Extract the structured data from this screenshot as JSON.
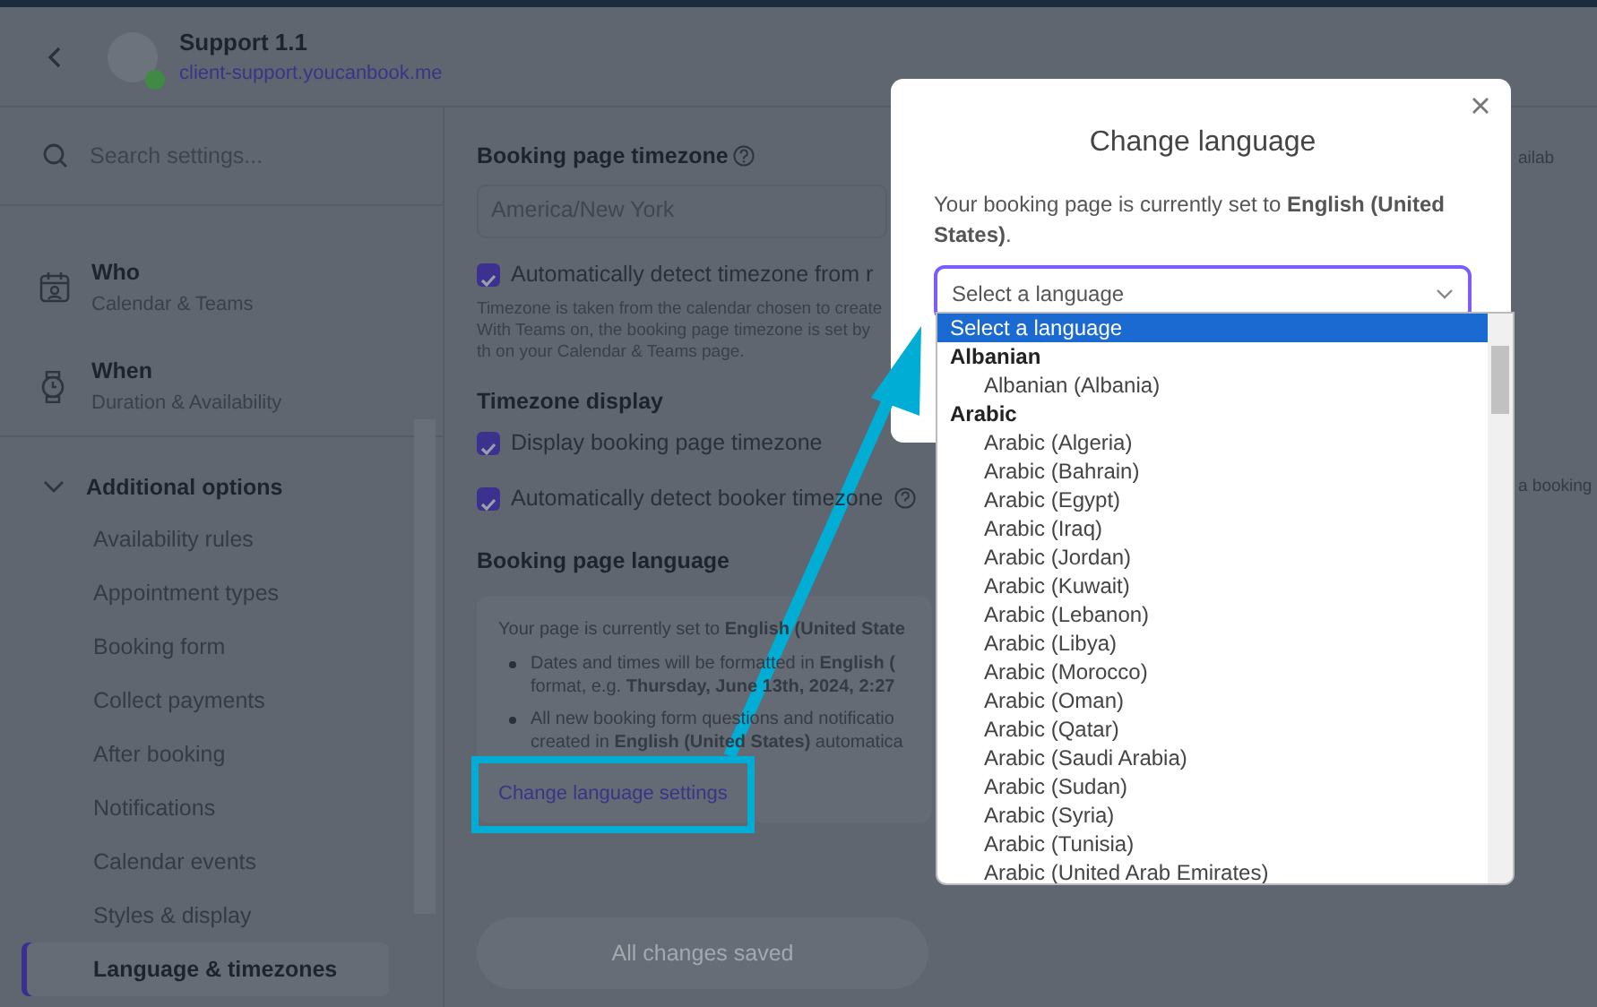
{
  "header": {
    "title": "Support 1.1",
    "url": "client-support.youcanbook.me",
    "online": true
  },
  "sidebar": {
    "search": {
      "placeholder": "Search settings..."
    },
    "sections": [
      {
        "title": "Who",
        "subtitle": "Calendar & Teams"
      },
      {
        "title": "When",
        "subtitle": "Duration & Availability"
      }
    ],
    "group": {
      "title": "Additional options",
      "expanded": true,
      "items": [
        {
          "label": "Availability rules",
          "selected": false
        },
        {
          "label": "Appointment types",
          "selected": false
        },
        {
          "label": "Booking form",
          "selected": false
        },
        {
          "label": "Collect payments",
          "selected": false
        },
        {
          "label": "After booking",
          "selected": false
        },
        {
          "label": "Notifications",
          "selected": false
        },
        {
          "label": "Calendar events",
          "selected": false
        },
        {
          "label": "Styles & display",
          "selected": false
        },
        {
          "label": "Language & timezones",
          "selected": true
        }
      ]
    }
  },
  "main": {
    "timezone": {
      "heading": "Booking page timezone",
      "value": "America/New York",
      "auto": {
        "label": "Automatically detect timezone from r",
        "checked": true
      },
      "help": "Timezone is taken from the calendar chosen to create With Teams on, the booking page timezone is set by th on your Calendar & Teams page."
    },
    "display": {
      "heading": "Timezone display",
      "options": [
        {
          "label": "Display booking page timezone",
          "checked": true
        },
        {
          "label": "Automatically detect booker timezone",
          "checked": true
        }
      ]
    },
    "language": {
      "heading": "Booking page language",
      "current": "Your page is currently set to **English (United State**",
      "bullets": [
        "Dates and times will be formatted in **English (** format, e.g. **Thursday, June 13th, 2024, 2:27**",
        "All new booking form questions and notificatio created in **English (United States)** automatica"
      ],
      "link": "Change language settings"
    },
    "save": {
      "label": "All changes saved",
      "disabled": true
    }
  },
  "right_fragments": [
    "ailab",
    "a booking"
  ],
  "modal": {
    "title": "Change language",
    "text": "Your booking page is currently set to **English (United States)**.",
    "select": {
      "placeholder": "Select a language",
      "expanded": true
    },
    "options": [
      {
        "label": "Select a language",
        "selected": true
      }
    ],
    "groups": [
      {
        "label": "Albanian",
        "children": [
          {
            "label": "Albanian (Albania)",
            "selected": false
          }
        ]
      },
      {
        "label": "Arabic",
        "children": [
          {
            "label": "Arabic (Algeria)",
            "selected": false
          },
          {
            "label": "Arabic (Bahrain)",
            "selected": false
          },
          {
            "label": "Arabic (Egypt)",
            "selected": false
          },
          {
            "label": "Arabic (Iraq)",
            "selected": false
          },
          {
            "label": "Arabic (Jordan)",
            "selected": false
          },
          {
            "label": "Arabic (Kuwait)",
            "selected": false
          },
          {
            "label": "Arabic (Lebanon)",
            "selected": false
          },
          {
            "label": "Arabic (Libya)",
            "selected": false
          },
          {
            "label": "Arabic (Morocco)",
            "selected": false
          },
          {
            "label": "Arabic (Oman)",
            "selected": false
          },
          {
            "label": "Arabic (Qatar)",
            "selected": false
          },
          {
            "label": "Arabic (Saudi Arabia)",
            "selected": false
          },
          {
            "label": "Arabic (Sudan)",
            "selected": false
          },
          {
            "label": "Arabic (Syria)",
            "selected": false
          },
          {
            "label": "Arabic (Tunisia)",
            "selected": false
          },
          {
            "label": "Arabic (United Arab Emirates)",
            "selected": false
          }
        ]
      }
    ]
  }
}
